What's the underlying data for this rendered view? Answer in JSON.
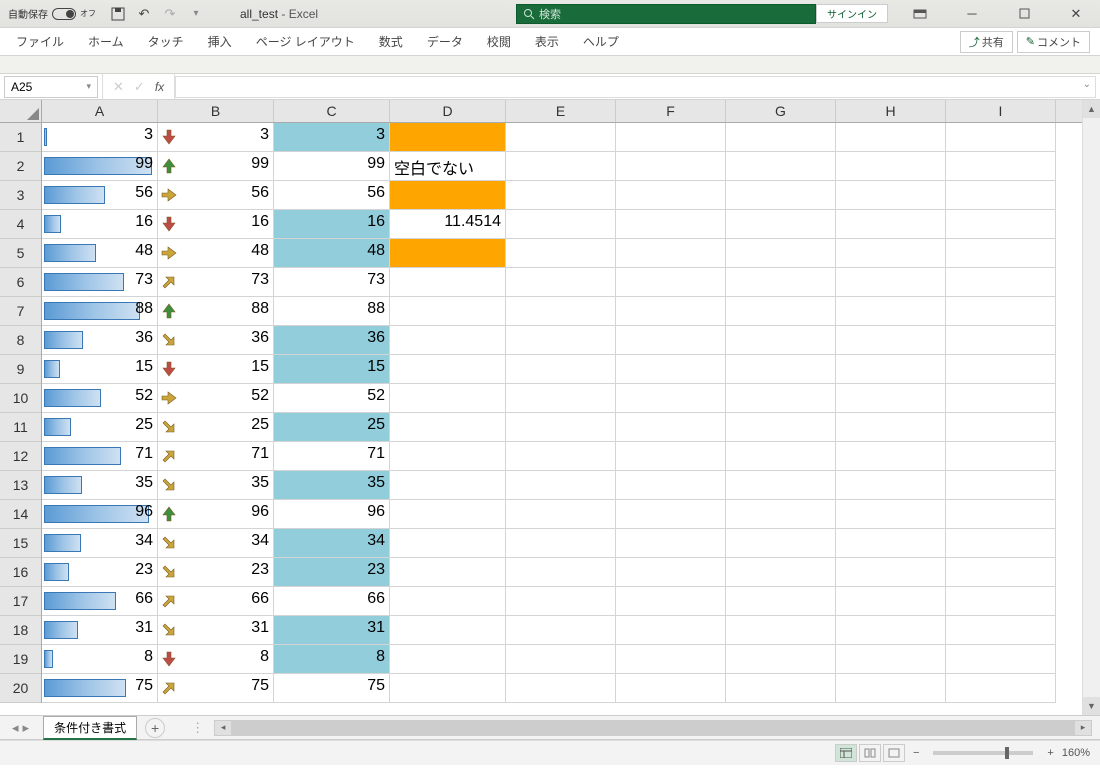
{
  "titlebar": {
    "autosave_label": "自動保存",
    "autosave_state": "オフ",
    "filename": "all_test",
    "app_suffix": "- Excel",
    "search_placeholder": "検索",
    "signin": "サインイン"
  },
  "ribbon": {
    "tabs": [
      "ファイル",
      "ホーム",
      "タッチ",
      "挿入",
      "ページ レイアウト",
      "数式",
      "データ",
      "校閲",
      "表示",
      "ヘルプ"
    ],
    "share": "共有",
    "comments": "コメント"
  },
  "formula": {
    "name_box": "A25",
    "fx": "fx"
  },
  "columns": [
    "A",
    "B",
    "C",
    "D",
    "E",
    "F",
    "G",
    "H",
    "I"
  ],
  "rows": [
    "1",
    "2",
    "3",
    "4",
    "5",
    "6",
    "7",
    "8",
    "9",
    "10",
    "11",
    "12",
    "13",
    "14",
    "15",
    "16",
    "17",
    "18",
    "19",
    "20"
  ],
  "dataA": [
    3,
    99,
    56,
    16,
    48,
    73,
    88,
    36,
    15,
    52,
    25,
    71,
    35,
    96,
    34,
    23,
    66,
    31,
    8,
    75
  ],
  "dataB": [
    3,
    99,
    56,
    16,
    48,
    73,
    88,
    36,
    15,
    52,
    25,
    71,
    35,
    96,
    34,
    23,
    66,
    31,
    8,
    75
  ],
  "iconB": [
    "down",
    "up",
    "right",
    "down",
    "right",
    "upright",
    "up",
    "downright",
    "down",
    "right",
    "downright",
    "upright",
    "downright",
    "up",
    "downright",
    "downright",
    "upright",
    "downright",
    "down",
    "upright"
  ],
  "dataC": [
    3,
    99,
    56,
    16,
    48,
    73,
    88,
    36,
    15,
    52,
    25,
    71,
    35,
    96,
    34,
    23,
    66,
    31,
    8,
    75
  ],
  "hlC": [
    1,
    0,
    0,
    1,
    1,
    0,
    0,
    1,
    1,
    0,
    1,
    0,
    1,
    0,
    1,
    1,
    0,
    1,
    1,
    0
  ],
  "dataD": [
    "",
    "空白でない",
    "",
    "11.4514",
    "",
    "",
    "",
    "",
    "",
    "",
    "",
    "",
    "",
    "",
    "",
    "",
    "",
    "",
    "",
    ""
  ],
  "orangeD": [
    1,
    0,
    1,
    0,
    1,
    0,
    0,
    0,
    0,
    0,
    0,
    0,
    0,
    0,
    0,
    0,
    0,
    0,
    0,
    0
  ],
  "sheet": {
    "tab": "条件付き書式"
  },
  "status": {
    "zoom": "160%"
  },
  "chart_data": {
    "type": "table",
    "note": "Excel conditional formatting demo: column A has data bars, column B has 5-arrow icon set, column C has highlight-if-below-average (blue), column D has mixed fills/values",
    "columns": [
      "A (databar)",
      "B (iconset)",
      "C (color scale/highlight)",
      "D"
    ],
    "rows": [
      {
        "A": 3,
        "B": 3,
        "B_icon": "down",
        "C": 3,
        "C_hl": true,
        "D": "",
        "D_fill": "orange"
      },
      {
        "A": 99,
        "B": 99,
        "B_icon": "up",
        "C": 99,
        "C_hl": false,
        "D": "空白でない",
        "D_fill": ""
      },
      {
        "A": 56,
        "B": 56,
        "B_icon": "right",
        "C": 56,
        "C_hl": false,
        "D": "",
        "D_fill": "orange"
      },
      {
        "A": 16,
        "B": 16,
        "B_icon": "down",
        "C": 16,
        "C_hl": true,
        "D": 11.4514,
        "D_fill": ""
      },
      {
        "A": 48,
        "B": 48,
        "B_icon": "right",
        "C": 48,
        "C_hl": true,
        "D": "",
        "D_fill": "orange"
      },
      {
        "A": 73,
        "B": 73,
        "B_icon": "upright",
        "C": 73,
        "C_hl": false,
        "D": "",
        "D_fill": ""
      },
      {
        "A": 88,
        "B": 88,
        "B_icon": "up",
        "C": 88,
        "C_hl": false,
        "D": "",
        "D_fill": ""
      },
      {
        "A": 36,
        "B": 36,
        "B_icon": "downright",
        "C": 36,
        "C_hl": true,
        "D": "",
        "D_fill": ""
      },
      {
        "A": 15,
        "B": 15,
        "B_icon": "down",
        "C": 15,
        "C_hl": true,
        "D": "",
        "D_fill": ""
      },
      {
        "A": 52,
        "B": 52,
        "B_icon": "right",
        "C": 52,
        "C_hl": false,
        "D": "",
        "D_fill": ""
      },
      {
        "A": 25,
        "B": 25,
        "B_icon": "downright",
        "C": 25,
        "C_hl": true,
        "D": "",
        "D_fill": ""
      },
      {
        "A": 71,
        "B": 71,
        "B_icon": "upright",
        "C": 71,
        "C_hl": false,
        "D": "",
        "D_fill": ""
      },
      {
        "A": 35,
        "B": 35,
        "B_icon": "downright",
        "C": 35,
        "C_hl": true,
        "D": "",
        "D_fill": ""
      },
      {
        "A": 96,
        "B": 96,
        "B_icon": "up",
        "C": 96,
        "C_hl": false,
        "D": "",
        "D_fill": ""
      },
      {
        "A": 34,
        "B": 34,
        "B_icon": "downright",
        "C": 34,
        "C_hl": true,
        "D": "",
        "D_fill": ""
      },
      {
        "A": 23,
        "B": 23,
        "B_icon": "downright",
        "C": 23,
        "C_hl": true,
        "D": "",
        "D_fill": ""
      },
      {
        "A": 66,
        "B": 66,
        "B_icon": "upright",
        "C": 66,
        "C_hl": false,
        "D": "",
        "D_fill": ""
      },
      {
        "A": 31,
        "B": 31,
        "B_icon": "downright",
        "C": 31,
        "C_hl": true,
        "D": "",
        "D_fill": ""
      },
      {
        "A": 8,
        "B": 8,
        "B_icon": "down",
        "C": 8,
        "C_hl": true,
        "D": "",
        "D_fill": ""
      },
      {
        "A": 75,
        "B": 75,
        "B_icon": "upright",
        "C": 75,
        "C_hl": false,
        "D": "",
        "D_fill": ""
      }
    ]
  }
}
